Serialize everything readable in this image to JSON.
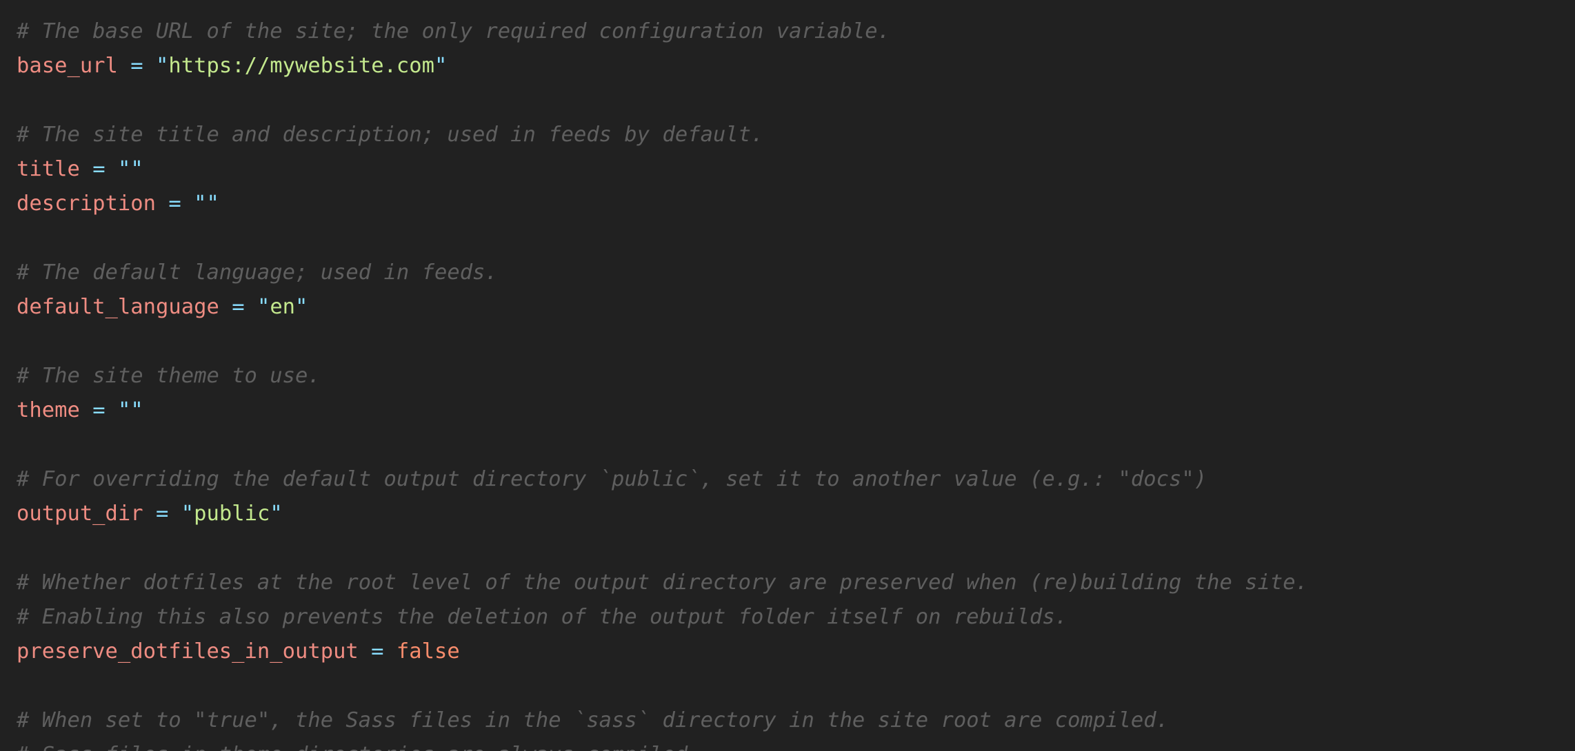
{
  "editor": {
    "language": "TOML",
    "theme_colors": {
      "background": "#212121",
      "comment": "#5f5f5f",
      "key": "#ee8c82",
      "operator": "#89ddff",
      "string": "#c3e88d",
      "boolean": "#f78c6c"
    },
    "lines": [
      {
        "type": "comment",
        "text": "# The base URL of the site; the only required configuration variable."
      },
      {
        "type": "assign",
        "key": "base_url",
        "eq": "=",
        "value_kind": "string",
        "value": "https://mywebsite.com"
      },
      {
        "type": "blank"
      },
      {
        "type": "comment",
        "text": "# The site title and description; used in feeds by default."
      },
      {
        "type": "assign",
        "key": "title",
        "eq": "=",
        "value_kind": "string",
        "value": ""
      },
      {
        "type": "assign",
        "key": "description",
        "eq": "=",
        "value_kind": "string",
        "value": ""
      },
      {
        "type": "blank"
      },
      {
        "type": "comment",
        "text": "# The default language; used in feeds."
      },
      {
        "type": "assign",
        "key": "default_language",
        "eq": "=",
        "value_kind": "string",
        "value": "en"
      },
      {
        "type": "blank"
      },
      {
        "type": "comment",
        "text": "# The site theme to use."
      },
      {
        "type": "assign",
        "key": "theme",
        "eq": "=",
        "value_kind": "string",
        "value": ""
      },
      {
        "type": "blank"
      },
      {
        "type": "comment",
        "text": "# For overriding the default output directory `public`, set it to another value (e.g.: \"docs\")"
      },
      {
        "type": "assign",
        "key": "output_dir",
        "eq": "=",
        "value_kind": "string",
        "value": "public"
      },
      {
        "type": "blank"
      },
      {
        "type": "comment",
        "text": "# Whether dotfiles at the root level of the output directory are preserved when (re)building the site."
      },
      {
        "type": "comment",
        "text": "# Enabling this also prevents the deletion of the output folder itself on rebuilds."
      },
      {
        "type": "assign",
        "key": "preserve_dotfiles_in_output",
        "eq": "=",
        "value_kind": "bool",
        "value": "false"
      },
      {
        "type": "blank"
      },
      {
        "type": "comment",
        "text": "# When set to \"true\", the Sass files in the `sass` directory in the site root are compiled."
      },
      {
        "type": "comment",
        "text": "# Sass files in theme directories are always compiled."
      }
    ]
  }
}
